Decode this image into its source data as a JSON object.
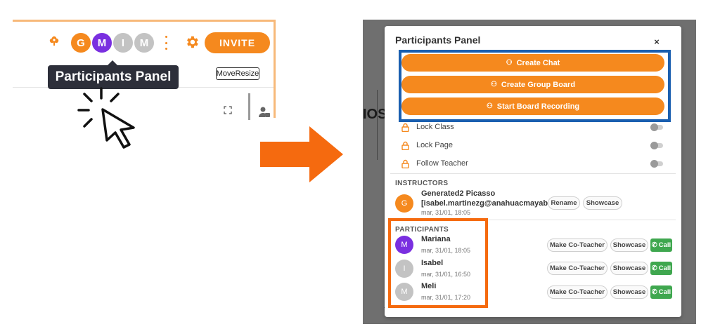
{
  "colors": {
    "accent": "#f5891e",
    "purple_avatar": "#7a2fe0",
    "gray_avatar": "#c3c3c3",
    "tooltip_bg": "#2d2f3a",
    "call_green": "#3fa74f",
    "highlight_blue": "#1a5fb0",
    "highlight_orange": "#f56a0f",
    "arrow": "#f56a0f"
  },
  "left": {
    "avatars": [
      "G",
      "M",
      "I",
      "M"
    ],
    "invite_label": "INVITE",
    "tooltip": "Participants Panel",
    "moveresize_label": "MoveResize",
    "icons": [
      "flower-icon",
      "kebab-icon",
      "gear-icon",
      "expand-icon",
      "user-card-icon",
      "cursor-click-icon"
    ]
  },
  "background": {
    "partial_text": "IOS"
  },
  "panel": {
    "title": "Participants Panel",
    "close_label": "×",
    "actions": [
      {
        "label": "Create Chat",
        "icon": "users-icon"
      },
      {
        "label": "Create Group Board",
        "icon": "users-icon"
      },
      {
        "label": "Start Board Recording",
        "icon": "users-icon"
      }
    ],
    "toggles": [
      {
        "label": "Lock Class",
        "on": false
      },
      {
        "label": "Lock Page",
        "on": false
      },
      {
        "label": "Follow Teacher",
        "on": false
      }
    ],
    "instructors_title": "INSTRUCTORS",
    "instructor": {
      "initial": "G",
      "name": "Generated2 Picasso",
      "email": "[isabel.martinezg@anahuacmayab.mx]",
      "time": "mar, 31/01, 18:05",
      "rename_label": "Rename",
      "showcase_label": "Showcase"
    },
    "participants_title": "PARTICIPANTS",
    "participants": [
      {
        "initial": "M",
        "name": "Mariana",
        "time": "mar, 31/01, 18:05",
        "color": "#7a2fe0"
      },
      {
        "initial": "I",
        "name": "Isabel",
        "time": "mar, 31/01, 16:50",
        "color": "#c3c3c3"
      },
      {
        "initial": "M",
        "name": "Meli",
        "time": "mar, 31/01, 17:20",
        "color": "#c3c3c3"
      }
    ],
    "make_cohost_label": "Make Co-Teacher",
    "showcase_label": "Showcase",
    "call_label": "Call"
  }
}
